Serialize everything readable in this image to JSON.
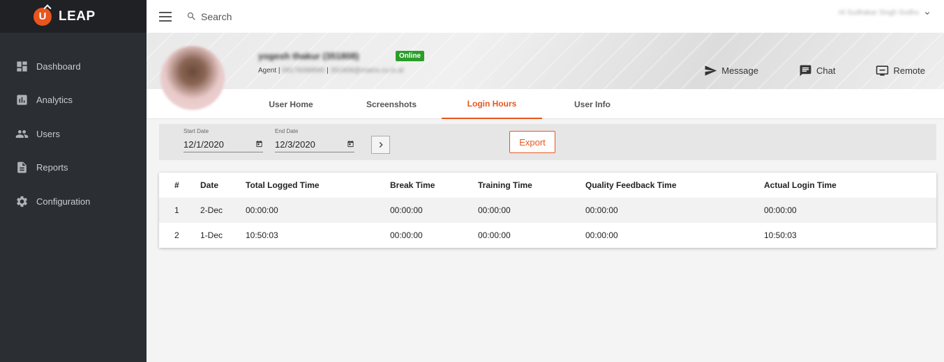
{
  "brand": {
    "name": "LEAP",
    "logo_letter": "U"
  },
  "sidebar": {
    "items": [
      {
        "label": "Dashboard",
        "icon": "dashboard-icon"
      },
      {
        "label": "Analytics",
        "icon": "analytics-icon"
      },
      {
        "label": "Users",
        "icon": "users-icon"
      },
      {
        "label": "Reports",
        "icon": "reports-icon"
      },
      {
        "label": "Configuration",
        "icon": "gear-icon"
      }
    ]
  },
  "topbar": {
    "search_placeholder": "Search",
    "user_name": "Hi Sudhakar Singh Sodhu"
  },
  "profile": {
    "name": "yogesh thakur (351808)",
    "status": "Online",
    "role_label": "Agent |",
    "phone": "08176098890",
    "separator": "|",
    "email": "351808@mains.co.in.al"
  },
  "actions": {
    "message": "Message",
    "chat": "Chat",
    "remote": "Remote"
  },
  "tabs": [
    {
      "label": "User Home",
      "active": false
    },
    {
      "label": "Screenshots",
      "active": false
    },
    {
      "label": "Login Hours",
      "active": true
    },
    {
      "label": "User Info",
      "active": false
    }
  ],
  "filter": {
    "start_label": "Start Date",
    "start_value": "12/1/2020",
    "end_label": "End Date",
    "end_value": "12/3/2020",
    "export_label": "Export"
  },
  "table": {
    "columns": [
      "#",
      "Date",
      "Total Logged Time",
      "Break Time",
      "Training Time",
      "Quality Feedback Time",
      "Actual Login Time"
    ],
    "rows": [
      [
        "1",
        "2-Dec",
        "00:00:00",
        "00:00:00",
        "00:00:00",
        "00:00:00",
        "00:00:00"
      ],
      [
        "2",
        "1-Dec",
        "10:50:03",
        "00:00:00",
        "00:00:00",
        "00:00:00",
        "10:50:03"
      ]
    ]
  },
  "colors": {
    "accent": "#e8561e",
    "sidebar": "#2b2e33",
    "online": "#2a9d2a"
  }
}
